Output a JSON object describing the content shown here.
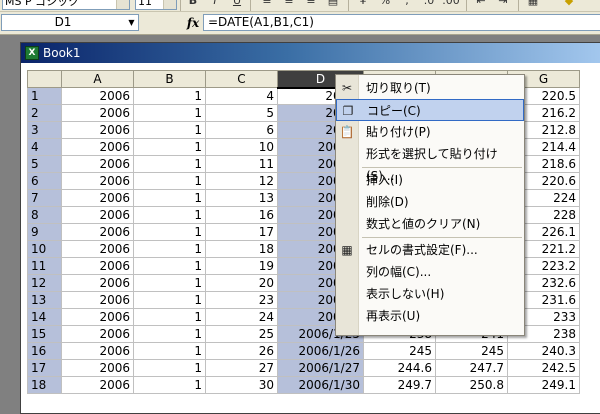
{
  "toolbar": {
    "font_name": "MS P ゴシック",
    "font_size": "11",
    "bold_label": "B",
    "italic_label": "I",
    "underline_label": "U"
  },
  "formula_bar": {
    "namebox_value": "D1",
    "fx_label": "fx",
    "formula": "=DATE(A1,B1,C1)"
  },
  "workbook": {
    "title": "Book1",
    "columns": [
      "A",
      "B",
      "C",
      "D",
      "E",
      "F",
      "G"
    ],
    "rows": [
      {
        "n": "1",
        "a": "2006",
        "b": "1",
        "c": "4",
        "d": "2006/",
        "g": "220.5"
      },
      {
        "n": "2",
        "a": "2006",
        "b": "1",
        "c": "5",
        "d": "2006/",
        "g": "216.2"
      },
      {
        "n": "3",
        "a": "2006",
        "b": "1",
        "c": "6",
        "d": "2006/",
        "g": "212.8"
      },
      {
        "n": "4",
        "a": "2006",
        "b": "1",
        "c": "10",
        "d": "2006/1",
        "g": "214.4"
      },
      {
        "n": "5",
        "a": "2006",
        "b": "1",
        "c": "11",
        "d": "2006/1",
        "g": "218.6"
      },
      {
        "n": "6",
        "a": "2006",
        "b": "1",
        "c": "12",
        "d": "2006/1",
        "g": "220.6"
      },
      {
        "n": "7",
        "a": "2006",
        "b": "1",
        "c": "13",
        "d": "2006/1",
        "g": "224"
      },
      {
        "n": "8",
        "a": "2006",
        "b": "1",
        "c": "16",
        "d": "2006/1",
        "g": "228"
      },
      {
        "n": "9",
        "a": "2006",
        "b": "1",
        "c": "17",
        "d": "2006/1",
        "g": "226.1"
      },
      {
        "n": "10",
        "a": "2006",
        "b": "1",
        "c": "18",
        "d": "2006/1",
        "g": "221.2"
      },
      {
        "n": "11",
        "a": "2006",
        "b": "1",
        "c": "19",
        "d": "2006/1",
        "g": "223.2"
      },
      {
        "n": "12",
        "a": "2006",
        "b": "1",
        "c": "20",
        "d": "2006/1",
        "g": "232.6"
      },
      {
        "n": "13",
        "a": "2006",
        "b": "1",
        "c": "23",
        "d": "2006/1",
        "g": "231.6"
      },
      {
        "n": "14",
        "a": "2006",
        "b": "1",
        "c": "24",
        "d": "2006/1",
        "g": "233"
      },
      {
        "n": "15",
        "a": "2006",
        "b": "1",
        "c": "25",
        "d": "2006/1/25",
        "e": "238",
        "f": "241",
        "g": "238"
      },
      {
        "n": "16",
        "a": "2006",
        "b": "1",
        "c": "26",
        "d": "2006/1/26",
        "e": "245",
        "f": "245",
        "g": "240.3"
      },
      {
        "n": "17",
        "a": "2006",
        "b": "1",
        "c": "27",
        "d": "2006/1/27",
        "e": "244.6",
        "f": "247.7",
        "g": "242.5"
      },
      {
        "n": "18",
        "a": "2006",
        "b": "1",
        "c": "30",
        "d": "2006/1/30",
        "e": "249.7",
        "f": "250.8",
        "g": "249.1"
      }
    ]
  },
  "context_menu": {
    "items": [
      {
        "label": "切り取り(T)",
        "icon": "scissors-icon",
        "glyph": "✂"
      },
      {
        "label": "コピー(C)",
        "icon": "copy-icon",
        "glyph": "❐",
        "hover": true
      },
      {
        "label": "貼り付け(P)",
        "icon": "paste-icon",
        "glyph": "📋"
      },
      {
        "label": "形式を選択して貼り付け(S)..."
      },
      {
        "label": "挿入(I)"
      },
      {
        "label": "削除(D)"
      },
      {
        "label": "数式と値のクリア(N)"
      },
      {
        "label": "セルの書式設定(F)...",
        "icon": "format-cells-icon",
        "glyph": "▦"
      },
      {
        "label": "列の幅(C)..."
      },
      {
        "label": "表示しない(H)"
      },
      {
        "label": "再表示(U)"
      }
    ]
  }
}
